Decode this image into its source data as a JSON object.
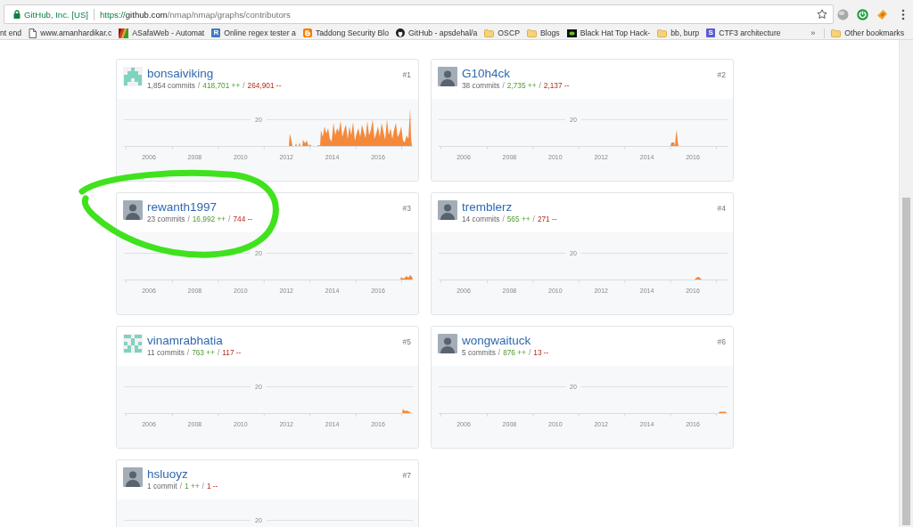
{
  "browser": {
    "security_label": "GitHub, Inc. [US]",
    "url_parts": [
      {
        "kind": "scheme",
        "text": "https://"
      },
      {
        "kind": "host",
        "text": "github.com"
      },
      {
        "kind": "path",
        "text": "/nmap/nmap/graphs/contributors"
      }
    ],
    "bookmarked": false
  },
  "bookmarks": [
    {
      "kind": "text",
      "title": "nt end"
    },
    {
      "kind": "page",
      "title": "www.amanhardikar.c"
    },
    {
      "kind": "stripes",
      "title": "ASafaWeb - Automat"
    },
    {
      "kind": "letter",
      "letter": "R",
      "color": "#3f7cc4",
      "title": "Online regex tester a"
    },
    {
      "kind": "tile",
      "title": "Taddong Security Blo"
    },
    {
      "kind": "cat",
      "title": "GitHub - apsdehal/a"
    },
    {
      "kind": "folder",
      "title": "OSCP"
    },
    {
      "kind": "folder",
      "title": "Blogs"
    },
    {
      "kind": "dark",
      "title": "Black Hat Top Hack-"
    },
    {
      "kind": "folder",
      "title": "bb, burp"
    },
    {
      "kind": "letter",
      "letter": "S",
      "color": "#5b5bd6",
      "title": "CTF3 architecture"
    }
  ],
  "bookmarks_overflow": "»",
  "other_bookmarks": {
    "kind": "folder",
    "title": "Other bookmarks"
  },
  "contributors": [
    {
      "rank": "#1",
      "name": "bonsaiviking",
      "avatar": {
        "kind": "identicon"
      },
      "stats": [
        {
          "kind": "commits",
          "text": "1,854 commits"
        },
        {
          "kind": "separator",
          "text": "/"
        },
        {
          "kind": "additions",
          "text": "418,701 ++"
        },
        {
          "kind": "separator",
          "text": "/"
        },
        {
          "kind": "deletions",
          "text": "264,901 --"
        }
      ],
      "chart": {
        "y_tick": "20",
        "x_ticks": [
          "2006",
          "2008",
          "2010",
          "2012",
          "2014",
          "2016"
        ]
      },
      "circled": false
    },
    {
      "rank": "#2",
      "name": "G10h4ck",
      "avatar": {
        "kind": "photo"
      },
      "stats": [
        {
          "kind": "commits",
          "text": "38 commits"
        },
        {
          "kind": "separator",
          "text": "/"
        },
        {
          "kind": "additions",
          "text": "2,735 ++"
        },
        {
          "kind": "separator",
          "text": "/"
        },
        {
          "kind": "deletions",
          "text": "2,137 --"
        }
      ],
      "chart": {
        "y_tick": "20",
        "x_ticks": [
          "2006",
          "2008",
          "2010",
          "2012",
          "2014",
          "2016"
        ]
      },
      "circled": false
    },
    {
      "rank": "#3",
      "name": "rewanth1997",
      "avatar": {
        "kind": "photo"
      },
      "stats": [
        {
          "kind": "commits",
          "text": "23 commits"
        },
        {
          "kind": "separator",
          "text": "/"
        },
        {
          "kind": "additions",
          "text": "16,992 ++"
        },
        {
          "kind": "separator",
          "text": "/"
        },
        {
          "kind": "deletions",
          "text": "744 --"
        }
      ],
      "chart": {
        "y_tick": "20",
        "x_ticks": [
          "2006",
          "2008",
          "2010",
          "2012",
          "2014",
          "2016"
        ]
      },
      "circled": true
    },
    {
      "rank": "#4",
      "name": "tremblerz",
      "avatar": {
        "kind": "photo"
      },
      "stats": [
        {
          "kind": "commits",
          "text": "14 commits"
        },
        {
          "kind": "separator",
          "text": "/"
        },
        {
          "kind": "additions",
          "text": "565 ++"
        },
        {
          "kind": "separator",
          "text": "/"
        },
        {
          "kind": "deletions",
          "text": "271 --"
        }
      ],
      "chart": {
        "y_tick": "20",
        "x_ticks": [
          "2006",
          "2008",
          "2010",
          "2012",
          "2014",
          "2016"
        ]
      },
      "circled": false
    },
    {
      "rank": "#5",
      "name": "vinamrabhatia",
      "avatar": {
        "kind": "identicon"
      },
      "stats": [
        {
          "kind": "commits",
          "text": "11 commits"
        },
        {
          "kind": "separator",
          "text": "/"
        },
        {
          "kind": "additions",
          "text": "763 ++"
        },
        {
          "kind": "separator",
          "text": "/"
        },
        {
          "kind": "deletions",
          "text": "117 --"
        }
      ],
      "chart": {
        "y_tick": "20",
        "x_ticks": [
          "2006",
          "2008",
          "2010",
          "2012",
          "2014",
          "2016"
        ]
      },
      "circled": false
    },
    {
      "rank": "#6",
      "name": "wongwaituck",
      "avatar": {
        "kind": "photo"
      },
      "stats": [
        {
          "kind": "commits",
          "text": "5 commits"
        },
        {
          "kind": "separator",
          "text": "/"
        },
        {
          "kind": "additions",
          "text": "876 ++"
        },
        {
          "kind": "separator",
          "text": "/"
        },
        {
          "kind": "deletions",
          "text": "13 --"
        }
      ],
      "chart": {
        "y_tick": "20",
        "x_ticks": [
          "2006",
          "2008",
          "2010",
          "2012",
          "2014",
          "2016"
        ]
      },
      "circled": false
    },
    {
      "rank": "#7",
      "name": "hsluoyz",
      "avatar": {
        "kind": "photo"
      },
      "stats": [
        {
          "kind": "commits",
          "text": "1 commit"
        },
        {
          "kind": "separator",
          "text": "/"
        },
        {
          "kind": "additions",
          "text": "1 ++"
        },
        {
          "kind": "separator",
          "text": "/"
        },
        {
          "kind": "deletions",
          "text": "1 --"
        }
      ],
      "chart": {
        "y_tick": "20"
      },
      "circled": false
    }
  ]
}
